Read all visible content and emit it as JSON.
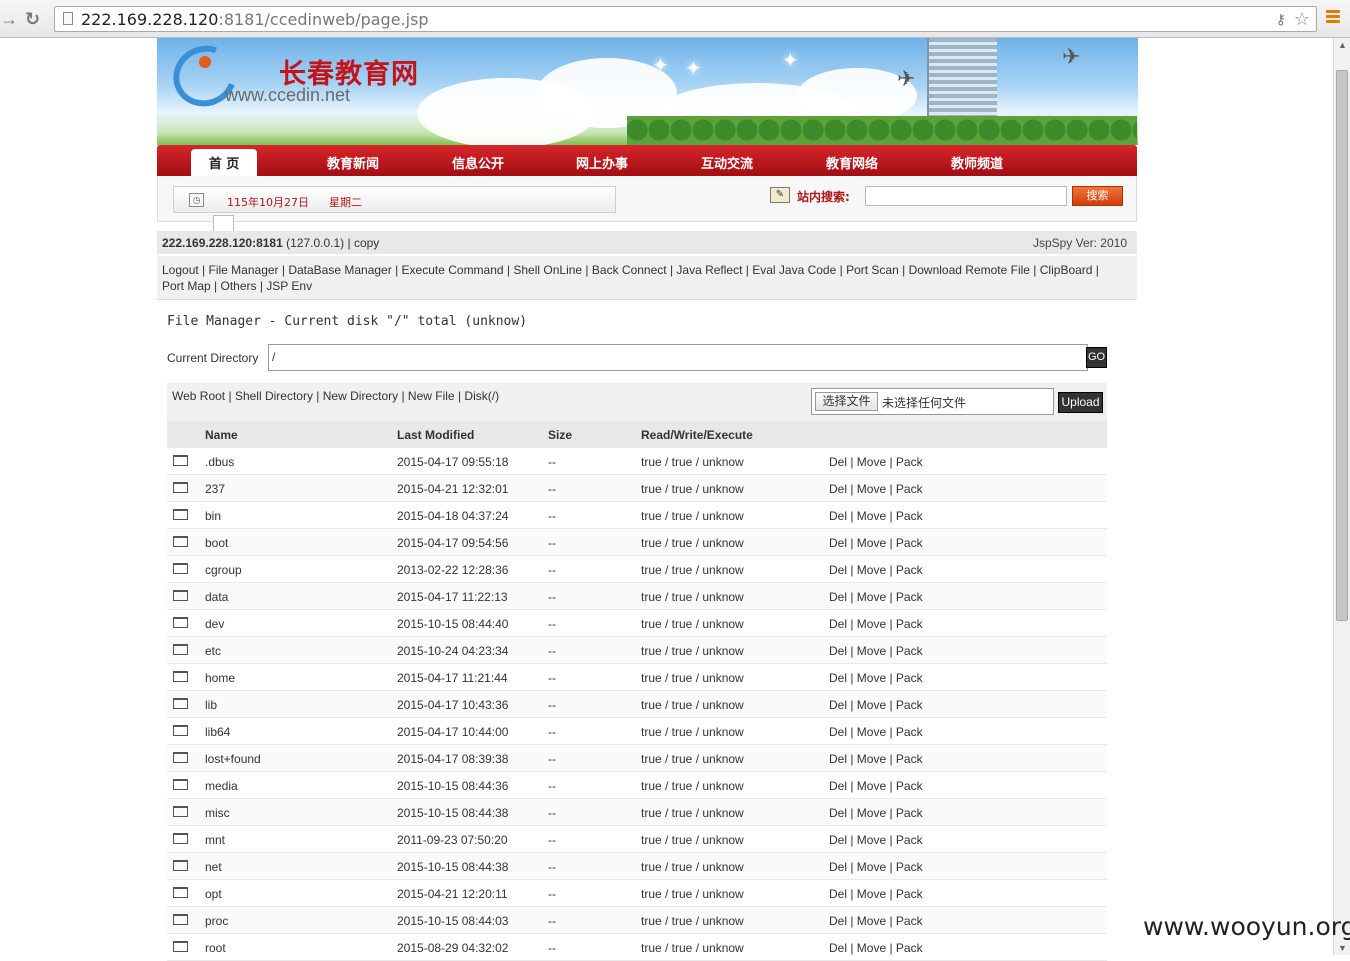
{
  "browser": {
    "url_host": "222.169.228.120",
    "url_rest": ":8181/ccedinweb/page.jsp"
  },
  "site": {
    "name": "长春教育网",
    "url_text": "www.ccedin.net",
    "nav": [
      "首 页",
      "教育新闻",
      "信息公开",
      "网上办事",
      "互动交流",
      "教育网络",
      "教师频道"
    ],
    "date": "115年10月27日",
    "weekday": "星期二",
    "search_label": "站内搜索:",
    "search_button": "搜索"
  },
  "spy": {
    "host": "222.169.228.120:8181",
    "host_local": " (127.0.0.1) | copy",
    "version": "JspSpy Ver: 2010",
    "menu": [
      "Logout",
      "File Manager",
      "DataBase Manager",
      "Execute Command",
      "Shell OnLine",
      "Back Connect",
      "Java Reflect",
      "Eval Java Code",
      "Port Scan",
      "Download Remote File",
      "ClipBoard",
      "Port Map",
      "Others",
      "JSP Env"
    ],
    "title": "File Manager - Current disk \"/\" total (unknow)",
    "current_dir_label": "Current Directory",
    "current_dir": "/",
    "go": "GO",
    "toolbar_links": [
      "Web Root",
      "Shell Directory",
      "New Directory",
      "New File",
      "Disk(/)"
    ],
    "choose_file": "选择文件",
    "no_file": "未选择任何文件",
    "upload": "Upload"
  },
  "table": {
    "headers": [
      "Name",
      "Last Modified",
      "Size",
      "Read/Write/Execute"
    ],
    "actions": "Del | Move | Pack",
    "rows": [
      {
        "name": ".dbus",
        "modified": "2015-04-17 09:55:18",
        "size": "--",
        "rwx": "true / true / unknow"
      },
      {
        "name": "237",
        "modified": "2015-04-21 12:32:01",
        "size": "--",
        "rwx": "true / true / unknow"
      },
      {
        "name": "bin",
        "modified": "2015-04-18 04:37:24",
        "size": "--",
        "rwx": "true / true / unknow"
      },
      {
        "name": "boot",
        "modified": "2015-04-17 09:54:56",
        "size": "--",
        "rwx": "true / true / unknow"
      },
      {
        "name": "cgroup",
        "modified": "2013-02-22 12:28:36",
        "size": "--",
        "rwx": "true / true / unknow"
      },
      {
        "name": "data",
        "modified": "2015-04-17 11:22:13",
        "size": "--",
        "rwx": "true / true / unknow"
      },
      {
        "name": "dev",
        "modified": "2015-10-15 08:44:40",
        "size": "--",
        "rwx": "true / true / unknow"
      },
      {
        "name": "etc",
        "modified": "2015-10-24 04:23:34",
        "size": "--",
        "rwx": "true / true / unknow"
      },
      {
        "name": "home",
        "modified": "2015-04-17 11:21:44",
        "size": "--",
        "rwx": "true / true / unknow"
      },
      {
        "name": "lib",
        "modified": "2015-04-17 10:43:36",
        "size": "--",
        "rwx": "true / true / unknow"
      },
      {
        "name": "lib64",
        "modified": "2015-04-17 10:44:00",
        "size": "--",
        "rwx": "true / true / unknow"
      },
      {
        "name": "lost+found",
        "modified": "2015-04-17 08:39:38",
        "size": "--",
        "rwx": "true / true / unknow"
      },
      {
        "name": "media",
        "modified": "2015-10-15 08:44:36",
        "size": "--",
        "rwx": "true / true / unknow"
      },
      {
        "name": "misc",
        "modified": "2015-10-15 08:44:38",
        "size": "--",
        "rwx": "true / true / unknow"
      },
      {
        "name": "mnt",
        "modified": "2011-09-23 07:50:20",
        "size": "--",
        "rwx": "true / true / unknow"
      },
      {
        "name": "net",
        "modified": "2015-10-15 08:44:38",
        "size": "--",
        "rwx": "true / true / unknow"
      },
      {
        "name": "opt",
        "modified": "2015-04-21 12:20:11",
        "size": "--",
        "rwx": "true / true / unknow"
      },
      {
        "name": "proc",
        "modified": "2015-10-15 08:44:03",
        "size": "--",
        "rwx": "true / true / unknow"
      },
      {
        "name": "root",
        "modified": "2015-08-29 04:32:02",
        "size": "--",
        "rwx": "true / true / unknow"
      }
    ]
  },
  "watermark": "www.wooyun.org"
}
